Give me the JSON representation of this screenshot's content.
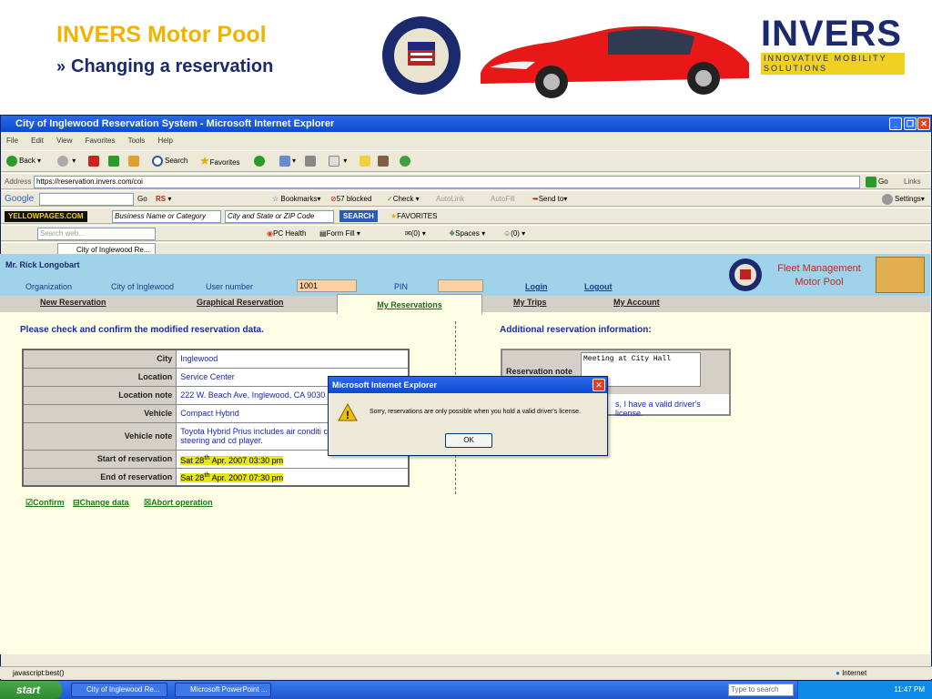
{
  "slide": {
    "title": "INVERS Motor Pool",
    "subtitle_arrow": "»",
    "subtitle": "Changing a reservation"
  },
  "logos": {
    "city_seal": "CITY OF INGLEWOOD INC. 1908 CALIFORNIA",
    "invers": "INVERS",
    "invers_tag": "INNOVATIVE MOBILITY SOLUTIONS"
  },
  "window": {
    "title": "City of Inglewood Reservation System - Microsoft Internet Explorer"
  },
  "menu": [
    "File",
    "Edit",
    "View",
    "Favorites",
    "Tools",
    "Help"
  ],
  "toolbar": {
    "back": "Back",
    "search": "Search",
    "favorites": "Favorites"
  },
  "address": {
    "label": "Address",
    "url": "https://reservation.invers.com/coi",
    "go": "Go",
    "links": "Links"
  },
  "google_bar": {
    "brand": "Google",
    "go": "Go",
    "bookmarks": "Bookmarks",
    "blocked": "57 blocked",
    "check": "Check",
    "autolink": "AutoLink",
    "autofill": "AutoFill",
    "send_to": "Send to",
    "settings": "Settings"
  },
  "yp_bar": {
    "brand": "YELLOWPAGES.COM",
    "business_placeholder": "Business Name or Category",
    "city_placeholder": "City and State or ZIP Code",
    "search": "SEARCH",
    "favorites": "FAVORITES"
  },
  "web_bar": {
    "search_placeholder": "Search web...",
    "pc_health": "PC Health",
    "form_fill": "Form Fill",
    "mail": "(0)",
    "spaces": "Spaces",
    "people": "(0)"
  },
  "tab": {
    "label": "City of Inglewood Re..."
  },
  "app": {
    "user_name": "Mr. Rick Longobart",
    "org_label": "Organization",
    "org_value": "City of Inglewood",
    "user_number_label": "User number",
    "user_number_value": "1001",
    "pin_label": "PIN",
    "login": "Login",
    "logout": "Logout",
    "brand_line1": "Fleet Management",
    "brand_line2": "Motor Pool"
  },
  "nav": [
    "New Reservation",
    "Graphical Reservation",
    "My Reservations",
    "My Trips",
    "My Account"
  ],
  "left": {
    "heading": "Please check and confirm the modified reservation data.",
    "rows": [
      {
        "label": "City",
        "value": "Inglewood"
      },
      {
        "label": "Location",
        "value": "Service Center"
      },
      {
        "label": "Location note",
        "value": "222 W. Beach Ave, Inglewood, CA 9030"
      },
      {
        "label": "Vehicle",
        "value": "Compact Hybrid"
      },
      {
        "label": "Vehicle note",
        "value": "Toyota Hybrid Prius includes air conditi control, power steering and cd player."
      }
    ],
    "start_label": "Start of reservation",
    "start_pre": "Sat 28",
    "start_sup": "th",
    "start_post": " Apr. 2007 03:30 pm",
    "end_label": "End of reservation",
    "end_pre": "Sat 28",
    "end_sup": "th",
    "end_post": " Apr. 2007 07:30 pm",
    "actions": [
      "Confirm",
      "Change data",
      "Abort operation"
    ]
  },
  "right": {
    "heading": "Additional reservation information:",
    "note_label": "Reservation note",
    "note_value": "Meeting at City Hall",
    "license": "s, I have a valid driver's license."
  },
  "dialog": {
    "title": "Microsoft Internet Explorer",
    "message": "Sorry, reservations are only possible when you hold a valid driver's license.",
    "ok": "OK"
  },
  "status": {
    "text": "javascript:best()",
    "zone": "Internet"
  },
  "taskbar": {
    "start": "start",
    "tasks": [
      "City of Inglewood Re...",
      "Microsoft PowerPoint ..."
    ],
    "search_placeholder": "Type to search",
    "clock": "11:47 PM"
  }
}
